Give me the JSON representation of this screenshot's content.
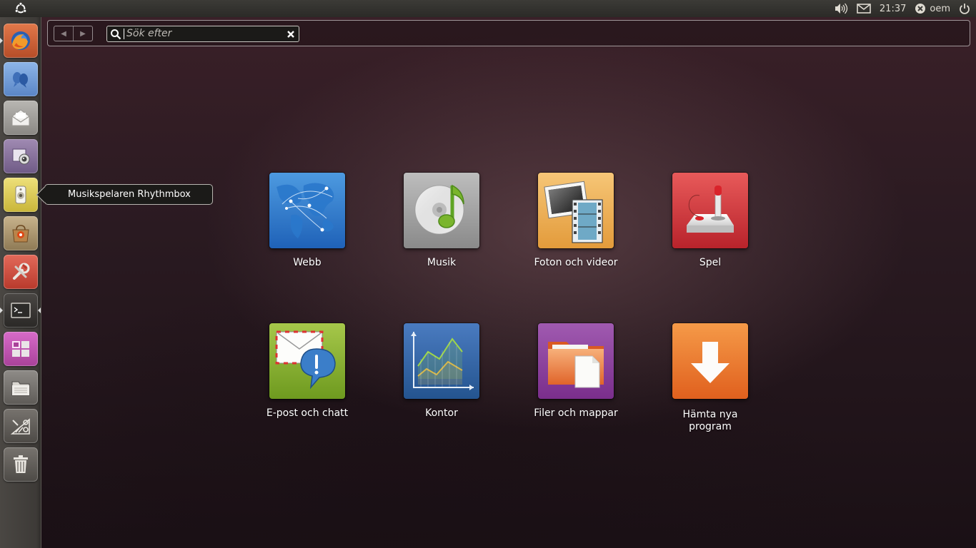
{
  "top_panel": {
    "time": "21:37",
    "user": "oem",
    "icons": [
      "ubuntu-logo-icon",
      "volume-icon",
      "mail-icon",
      "user-status-icon",
      "power-icon"
    ]
  },
  "launcher": {
    "items": [
      {
        "name": "Firefox",
        "icon": "firefox-icon"
      },
      {
        "name": "Empathy",
        "icon": "empathy-icon"
      },
      {
        "name": "Mail",
        "icon": "mail-client-icon"
      },
      {
        "name": "Cheese",
        "icon": "webcam-icon"
      },
      {
        "name": "Rhythmbox",
        "icon": "rhythmbox-icon"
      },
      {
        "name": "Software Center",
        "icon": "software-center-icon"
      },
      {
        "name": "System Settings",
        "icon": "settings-icon"
      },
      {
        "name": "Terminal",
        "icon": "terminal-icon"
      },
      {
        "name": "Workspaces",
        "icon": "workspace-switcher-icon"
      },
      {
        "name": "Files",
        "icon": "file-manager-icon"
      },
      {
        "name": "Applications",
        "icon": "applications-icon"
      },
      {
        "name": "Trash",
        "icon": "trash-icon"
      }
    ],
    "tooltip": "Musikspelaren Rhythmbox"
  },
  "search": {
    "placeholder": "Sök efter"
  },
  "categories": [
    {
      "label": "Webb",
      "icon": "web-globe-icon"
    },
    {
      "label": "Musik",
      "icon": "music-cd-icon"
    },
    {
      "label": "Foton och videor",
      "icon": "photos-videos-icon"
    },
    {
      "label": "Spel",
      "icon": "joystick-icon"
    },
    {
      "label": "E-post och chatt",
      "icon": "mail-chat-icon"
    },
    {
      "label": "Kontor",
      "icon": "office-chart-icon"
    },
    {
      "label": "Filer och mappar",
      "icon": "folder-icon"
    },
    {
      "label": "Hämta nya program",
      "icon": "download-arrow-icon"
    }
  ],
  "colors": {
    "panel": "#3c3b37",
    "dash_bg": "#2a1a21",
    "accent_orange": "#f07746"
  }
}
